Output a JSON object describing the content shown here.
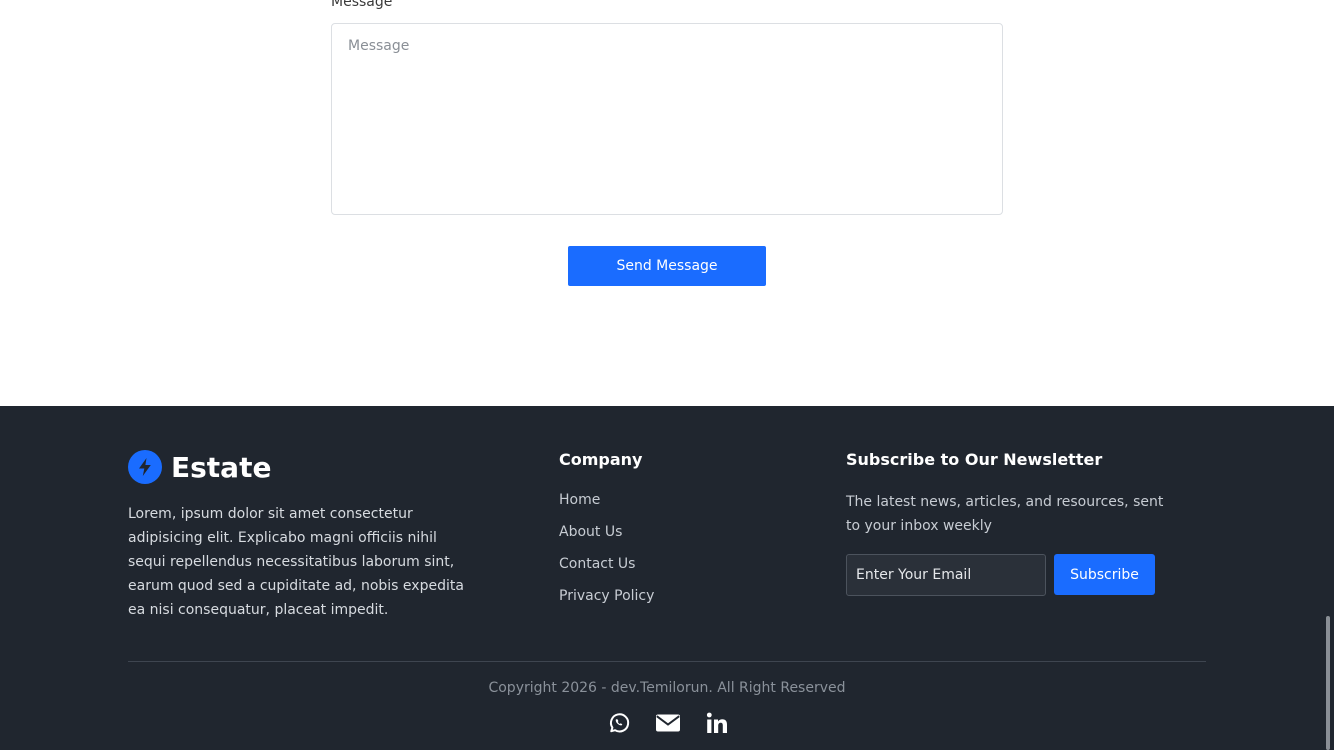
{
  "form": {
    "message_label": "Message",
    "message_placeholder": "Message",
    "send_label": "Send Message"
  },
  "footer": {
    "brand_name": "Estate",
    "about_text": "Lorem, ipsum dolor sit amet consectetur adipisicing elit. Explicabo magni officiis nihil sequi repellendus necessitatibus laborum sint, earum quod sed a cupiditate ad, nobis expedita ea nisi consequatur, placeat impedit.",
    "company_heading": "Company",
    "company_links": [
      "Home",
      "About Us",
      "Contact Us",
      "Privacy Policy"
    ],
    "newsletter_heading": "Subscribe to Our Newsletter",
    "newsletter_text": "The latest news, articles, and resources, sent to your inbox weekly",
    "email_placeholder": "Enter Your Email",
    "subscribe_label": "Subscribe",
    "copyright": "Copyright 2026 - dev.Temilorun. All Right Reserved",
    "socials": [
      "whatsapp-icon",
      "envelope-icon",
      "linkedin-icon"
    ]
  },
  "colors": {
    "accent": "#1a6cff",
    "footer_bg": "#20262f",
    "page_bg": "#ffffff"
  }
}
